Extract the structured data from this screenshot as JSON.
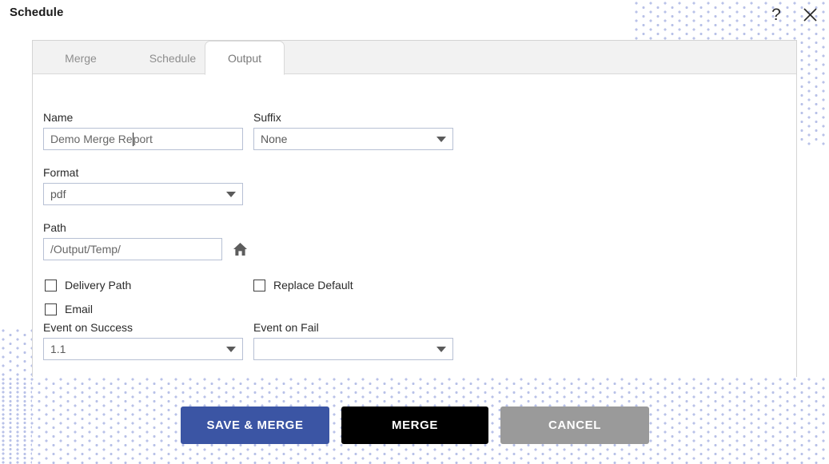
{
  "window": {
    "title": "Schedule",
    "help_icon": "question-mark-icon",
    "close_icon": "close-icon"
  },
  "tabs": [
    {
      "id": "merge",
      "label": "Merge",
      "active": false
    },
    {
      "id": "schedule",
      "label": "Schedule",
      "active": false
    },
    {
      "id": "output",
      "label": "Output",
      "active": true
    }
  ],
  "form": {
    "name": {
      "label": "Name",
      "value": "Demo Merge Report",
      "value_before_caret": "Demo Merge Re",
      "value_after_caret": "port",
      "placeholder": "Name"
    },
    "suffix": {
      "label": "Suffix",
      "value": "None",
      "options": [
        "None"
      ]
    },
    "format": {
      "label": "Format",
      "value": "pdf",
      "options": [
        "pdf"
      ]
    },
    "path": {
      "label": "Path",
      "value": "/Output/Temp/",
      "placeholder": "/Output/Temp/",
      "home_icon": "home-icon"
    },
    "checkboxes": [
      {
        "id": "delivery-path",
        "label": "Delivery Path",
        "checked": false
      },
      {
        "id": "email",
        "label": "Email",
        "checked": false
      },
      {
        "id": "replace-default",
        "label": "Replace Default",
        "checked": false
      }
    ],
    "event_on_success": {
      "label": "Event on Success",
      "value": "1.1",
      "options": [
        "1.1"
      ]
    },
    "event_on_fail": {
      "label": "Event on Fail",
      "value": "",
      "options": []
    }
  },
  "footer": {
    "buttons": [
      {
        "id": "save-merge",
        "label": "SAVE & MERGE",
        "color": "#3b55a4"
      },
      {
        "id": "merge",
        "label": "MERGE",
        "color": "#000000"
      },
      {
        "id": "cancel",
        "label": "CANCEL",
        "color": "#9a9a9a"
      }
    ]
  },
  "theme": {
    "accent": "#3b55a4",
    "panel_border": "#d4d4d4",
    "tab_bar_bg": "#f2f2f2",
    "field_border": "#b7c0d4",
    "dot_pattern": "#b9c2e8"
  }
}
